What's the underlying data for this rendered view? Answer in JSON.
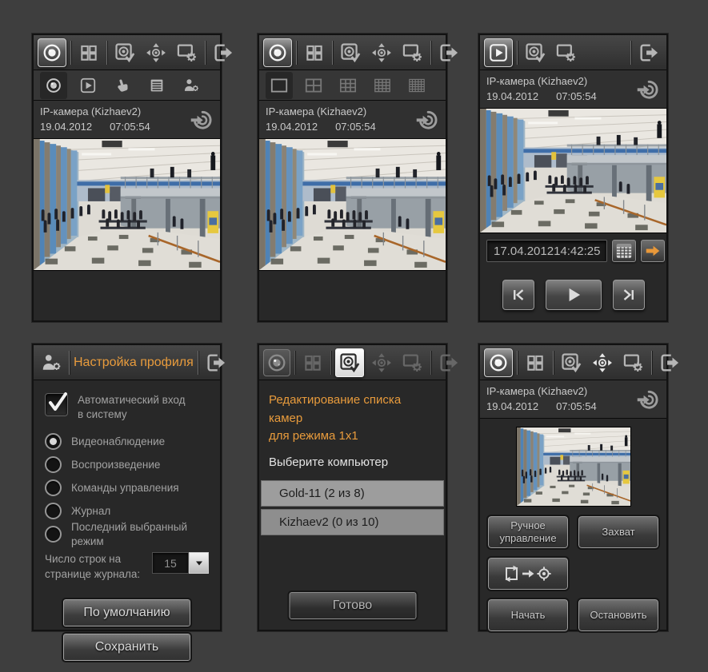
{
  "colors": {
    "page_bg": "#3e3e3e",
    "panel_bg": "#282828",
    "accent_orange": "#e89b3c",
    "toolbar_icon": "#b6b6b6",
    "list_item_light_bg": "#9d9d9d",
    "list_item_dark_bg": "#8e8e8e"
  },
  "icons": {
    "live_view": "camera-lens-icon",
    "layouts": "grid-2x2-icon",
    "camera_select": "camera-check-icon",
    "ptz_mode": "pan-tilt-crosshair-icon",
    "settings": "monitor-gear-icon",
    "exit": "exit-door-arrow-icon",
    "playback_mode": "play-icon",
    "manual_mode": "pointing-hand-icon",
    "log_mode": "list-lines-icon",
    "profile_mode": "user-gear-icon",
    "connect": "arrow-into-spiral-icon",
    "calendar": "calendar-grid-icon",
    "go": "orange-arrow-icon",
    "step_back": "skip-to-start-icon",
    "play_button": "play-triangle-icon",
    "step_forward": "skip-to-end-icon",
    "tour_to_preset": "loop-arrow-target-icon",
    "dropdown": "down-triangle-icon",
    "layout_options": [
      "layout-1x1-icon",
      "layout-2x2-icon",
      "layout-3x3-icon",
      "layout-4x4-icon",
      "layout-5x5-icon"
    ]
  },
  "panels": {
    "live1": {
      "camera_label": "IP-камера (Kizhaev2)",
      "camera_date": "19.04.2012",
      "camera_time": "07:05:54"
    },
    "live2": {
      "camera_label": "IP-камера (Kizhaev2)",
      "camera_date": "19.04.2012",
      "camera_time": "07:05:54"
    },
    "playback": {
      "camera_label": "IP-камера (Kizhaev2)",
      "camera_date": "19.04.2012",
      "camera_time": "07:05:54",
      "position_date": "17.04.2012",
      "position_time": "14:42:25"
    },
    "profile": {
      "title": "Настройка профиля",
      "auto_login_label": "Автоматический вход\nв систему",
      "auto_login_checked": true,
      "modes": [
        {
          "label": "Видеонаблюдение",
          "selected": true
        },
        {
          "label": "Воспроизведение",
          "selected": false
        },
        {
          "label": "Команды управления",
          "selected": false
        },
        {
          "label": "Журнал",
          "selected": false
        },
        {
          "label": "Последний выбранный режим",
          "selected": false
        }
      ],
      "rows_label": "Число строк на\nстранице журнала:",
      "rows_value": "15",
      "default_button": "По умолчанию",
      "save_button": "Сохранить"
    },
    "camera_list": {
      "title": "Редактирование списка камер\nдля режима 1x1",
      "subtitle": "Выберите компьютер",
      "computers": [
        {
          "label": "Gold-11 (2 из 8)"
        },
        {
          "label": "Kizhaev2 (0 из 10)"
        }
      ],
      "done_button": "Готово"
    },
    "ptz": {
      "camera_label": "IP-камера (Kizhaev2)",
      "camera_date": "19.04.2012",
      "camera_time": "07:05:54",
      "manual_button": "Ручное\nуправление",
      "capture_button": "Захват",
      "start_button": "Начать",
      "stop_button": "Остановить"
    }
  }
}
